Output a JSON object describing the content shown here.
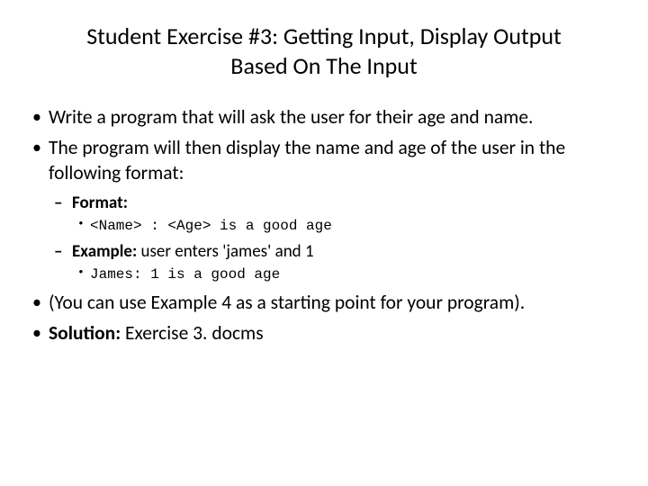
{
  "title": "Student Exercise #3: Getting Input, Display Output Based On The Input",
  "bullets": {
    "b1": "Write a program that will ask the user for their age and name.",
    "b2": "The program will then display the name and age of the user in the following format:",
    "b3": "(You can use Example 4 as a starting point for your program).",
    "b4_label": "Solution:",
    "b4_value": " Exercise 3. docms"
  },
  "sub": {
    "format_label": "Format:",
    "format_code": "<Name> : <Age> is a good age",
    "example_label": "Example:",
    "example_text": " user enters 'james' and 1",
    "example_code": "James: 1 is a good age"
  }
}
